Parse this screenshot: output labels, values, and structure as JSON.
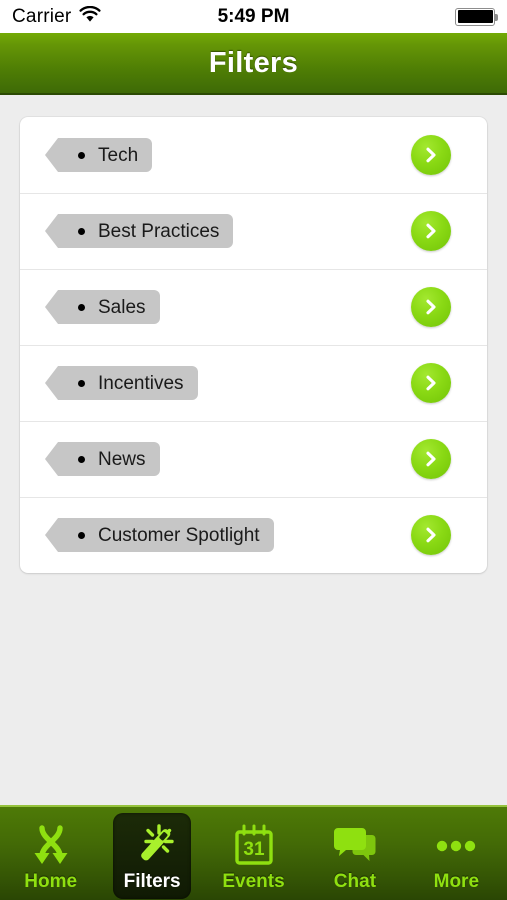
{
  "statusbar": {
    "carrier": "Carrier",
    "time": "5:49 PM",
    "wifi_icon": "wifi-icon",
    "battery_icon": "battery-full-icon"
  },
  "navbar": {
    "title": "Filters"
  },
  "colors": {
    "accent_green": "#8ad914",
    "header_top": "#74ab06",
    "header_bottom": "#3e6a06",
    "tabbar_top": "#4e7a07",
    "tabbar_bottom": "#2a4604",
    "tag_gray": "#c6c6c6",
    "page_background": "#ededed",
    "card_background": "#ffffff",
    "tab_label_green": "#8fe010"
  },
  "filters": {
    "items": [
      {
        "label": "Tech",
        "bullet": "bullet-dot",
        "action_icon": "chevron-right-icon"
      },
      {
        "label": "Best Practices",
        "bullet": "bullet-dot",
        "action_icon": "chevron-right-icon"
      },
      {
        "label": "Sales",
        "bullet": "bullet-dot",
        "action_icon": "chevron-right-icon"
      },
      {
        "label": "Incentives",
        "bullet": "bullet-dot",
        "action_icon": "chevron-right-icon"
      },
      {
        "label": "News",
        "bullet": "bullet-dot",
        "action_icon": "chevron-right-icon"
      },
      {
        "label": "Customer Spotlight",
        "bullet": "bullet-dot",
        "action_icon": "chevron-right-icon"
      }
    ]
  },
  "tabbar": {
    "items": [
      {
        "label": "Home",
        "icon": "crossing-arrows-icon",
        "active": false
      },
      {
        "label": "Filters",
        "icon": "magic-wand-icon",
        "active": true
      },
      {
        "label": "Events",
        "icon": "calendar-icon",
        "active": false,
        "calendar_day": "31"
      },
      {
        "label": "Chat",
        "icon": "chat-bubbles-icon",
        "active": false
      },
      {
        "label": "More",
        "icon": "ellipsis-icon",
        "active": false
      }
    ]
  }
}
